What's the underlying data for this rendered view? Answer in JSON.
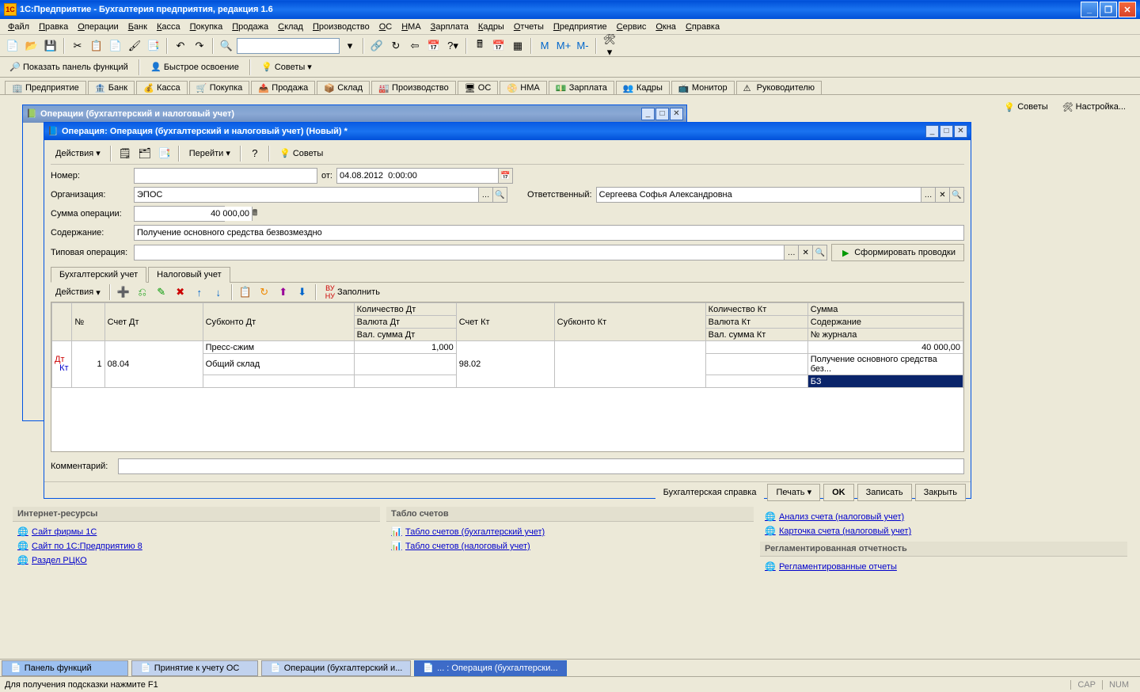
{
  "app": {
    "title": "1С:Предприятие - Бухгалтерия предприятия, редакция 1.6",
    "icon_label": "1C"
  },
  "menus": [
    "Файл",
    "Правка",
    "Операции",
    "Банк",
    "Касса",
    "Покупка",
    "Продажа",
    "Склад",
    "Производство",
    "ОС",
    "НМА",
    "Зарплата",
    "Кадры",
    "Отчеты",
    "Предприятие",
    "Сервис",
    "Окна",
    "Справка"
  ],
  "toolbar2": {
    "show_panel": "Показать панель функций",
    "quick_start": "Быстрое освоение",
    "tips": "Советы"
  },
  "navtabs": [
    "Предприятие",
    "Банк",
    "Касса",
    "Покупка",
    "Продажа",
    "Склад",
    "Производство",
    "ОС",
    "НМА",
    "Зарплата",
    "Кадры",
    "Монитор",
    "Руководителю"
  ],
  "m_buttons": [
    "М",
    "М+",
    "М-"
  ],
  "advice": {
    "tips": "Советы",
    "setup": "Настройка..."
  },
  "bg_window": {
    "title": "Операции (бухгалтерский и налоговый учет)"
  },
  "dialog": {
    "title": "Операция: Операция (бухгалтерский и налоговый учет) (Новый) *",
    "actions": "Действия",
    "goto": "Перейти",
    "tips": "Советы",
    "labels": {
      "number": "Номер:",
      "from": "от:",
      "org": "Организация:",
      "org_val": "ЭПОС",
      "resp": "Ответственный:",
      "resp_val": "Сергеева Софья Александровна",
      "sum": "Сумма операции:",
      "sum_val": "40 000,00",
      "date_val": "04.08.2012  0:00:00",
      "content": "Содержание:",
      "content_val": "Получение основного средства безвозмездно",
      "type_op": "Типовая операция:",
      "make_entries": "Сформировать проводки",
      "comment": "Комментарий:"
    },
    "tabs": [
      "Бухгалтерский учет",
      "Налоговый учет"
    ],
    "grid_toolbar": {
      "actions": "Действия",
      "fill": "Заполнить"
    },
    "grid": {
      "headers": {
        "n": "№",
        "acct_dt": "Счет Дт",
        "subk_dt": "Субконто Дт",
        "qty_dt": "Количество Дт",
        "cur_dt": "Валюта Дт",
        "val_sum_dt": "Вал. сумма Дт",
        "acct_kt": "Счет Кт",
        "subk_kt": "Субконто Кт",
        "qty_kt": "Количество Кт",
        "cur_kt": "Валюта Кт",
        "val_sum_kt": "Вал. сумма Кт",
        "sum": "Сумма",
        "content": "Содержание",
        "journal": "№ журнала"
      },
      "row": {
        "n": "1",
        "acct_dt": "08.04",
        "subk_dt1": "Пресс-сжим",
        "subk_dt2": "Общий склад",
        "qty_dt": "1,000",
        "acct_kt": "98.02",
        "sum": "40 000,00",
        "content": "Получение основного средства без...",
        "journal": "БЗ"
      }
    },
    "footer": {
      "book_ref": "Бухгалтерская справка",
      "print": "Печать",
      "ok": "OK",
      "save": "Записать",
      "close": "Закрыть"
    }
  },
  "panels": {
    "internet": {
      "title": "Интернет-ресурсы",
      "links": [
        "Сайт фирмы 1С",
        "Сайт по 1С:Предприятию 8",
        "Раздел РЦКО"
      ]
    },
    "tablo": {
      "title": "Табло счетов",
      "links": [
        "Табло счетов (бухгалтерский учет)",
        "Табло счетов (налоговый учет)"
      ]
    },
    "right_top": {
      "links": [
        "Анализ счета (налоговый учет)",
        "Карточка счета (налоговый учет)"
      ]
    },
    "reg": {
      "title": "Регламентированная отчетность",
      "links": [
        "Регламентированные отчеты"
      ]
    }
  },
  "taskbar": [
    "Панель функций",
    "Принятие к учету ОС",
    "Операции (бухгалтерский и...",
    "... : Операция (бухгалтерски..."
  ],
  "status": {
    "text": "Для получения подсказки нажмите F1",
    "cap": "CAP",
    "num": "NUM"
  }
}
